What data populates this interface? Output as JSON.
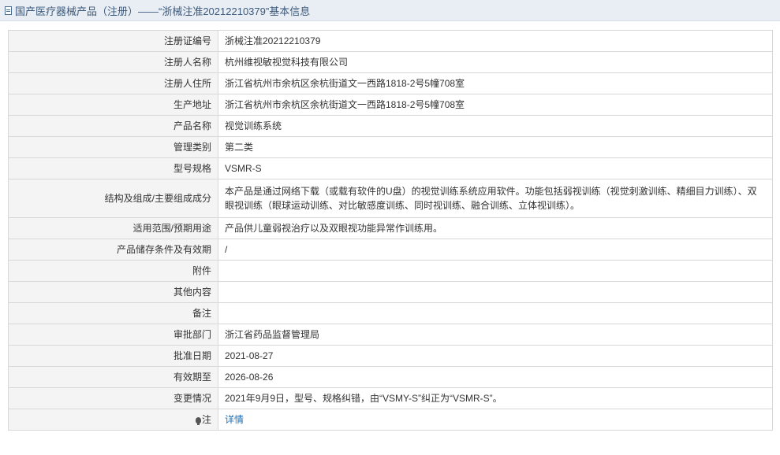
{
  "header": {
    "icon": "document-icon",
    "title": "国产医疗器械产品（注册）——“浙械注准20212210379”基本信息"
  },
  "rows": [
    {
      "label": "注册证编号",
      "value": "浙械注准20212210379"
    },
    {
      "label": "注册人名称",
      "value": "杭州维视敏视觉科技有限公司"
    },
    {
      "label": "注册人住所",
      "value": "浙江省杭州市余杭区余杭街道文一西路1818-2号5幢708室"
    },
    {
      "label": "生产地址",
      "value": "浙江省杭州市余杭区余杭街道文一西路1818-2号5幢708室"
    },
    {
      "label": "产品名称",
      "value": "视觉训练系统"
    },
    {
      "label": "管理类别",
      "value": "第二类"
    },
    {
      "label": "型号规格",
      "value": "VSMR-S"
    },
    {
      "label": "结构及组成/主要组成成分",
      "value": "本产品是通过网络下载（或载有软件的U盘）的视觉训练系统应用软件。功能包括弱视训练（视觉刺激训练、精细目力训练）、双眼视训练（眼球运动训练、对比敏感度训练、同时视训练、融合训练、立体视训练）。"
    },
    {
      "label": "适用范围/预期用途",
      "value": "产品供儿童弱视治疗以及双眼视功能异常作训练用。"
    },
    {
      "label": "产品储存条件及有效期",
      "value": "/"
    },
    {
      "label": "附件",
      "value": ""
    },
    {
      "label": "其他内容",
      "value": ""
    },
    {
      "label": "备注",
      "value": ""
    },
    {
      "label": "审批部门",
      "value": "浙江省药品监督管理局"
    },
    {
      "label": "批准日期",
      "value": "2021-08-27"
    },
    {
      "label": "有效期至",
      "value": "2026-08-26"
    },
    {
      "label": "变更情况",
      "value": "2021年9月9日，型号、规格纠错，由“VSMY-S”纠正为“VSMR-S”。"
    }
  ],
  "note": {
    "icon": "lightbulb-icon",
    "label": "注",
    "link": "详情"
  }
}
